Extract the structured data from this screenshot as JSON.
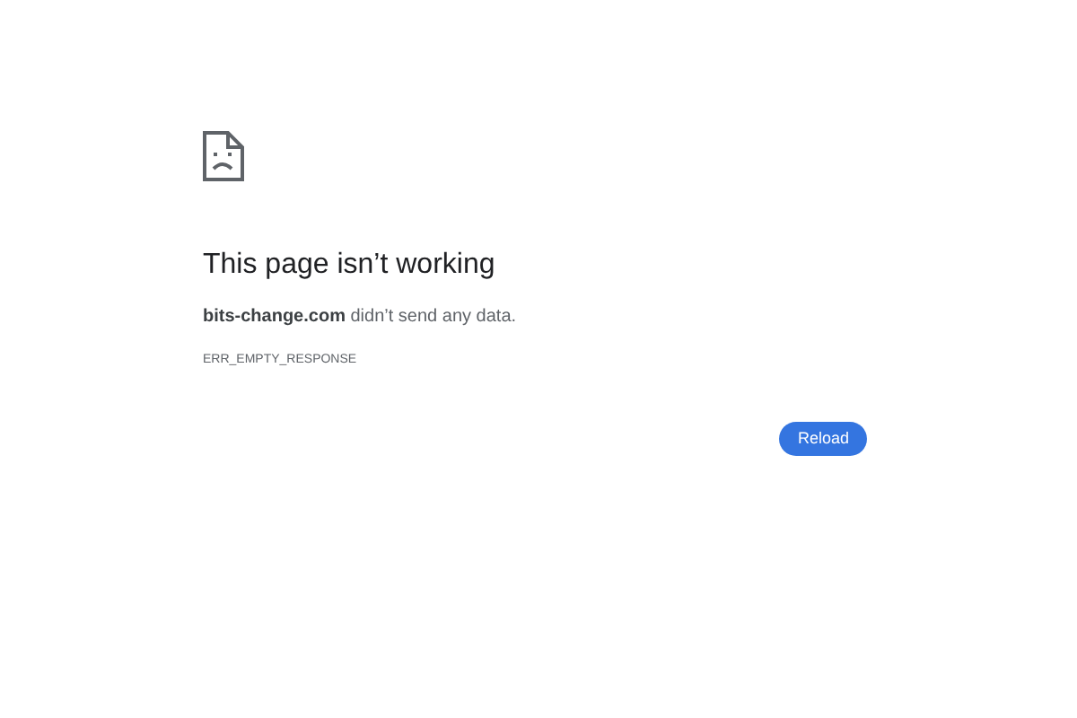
{
  "error": {
    "heading": "This page isn’t working",
    "message": "**bits-change.com** didn’t send any data.",
    "code": "ERR_EMPTY_RESPONSE"
  },
  "buttons": [
    "Reload"
  ]
}
